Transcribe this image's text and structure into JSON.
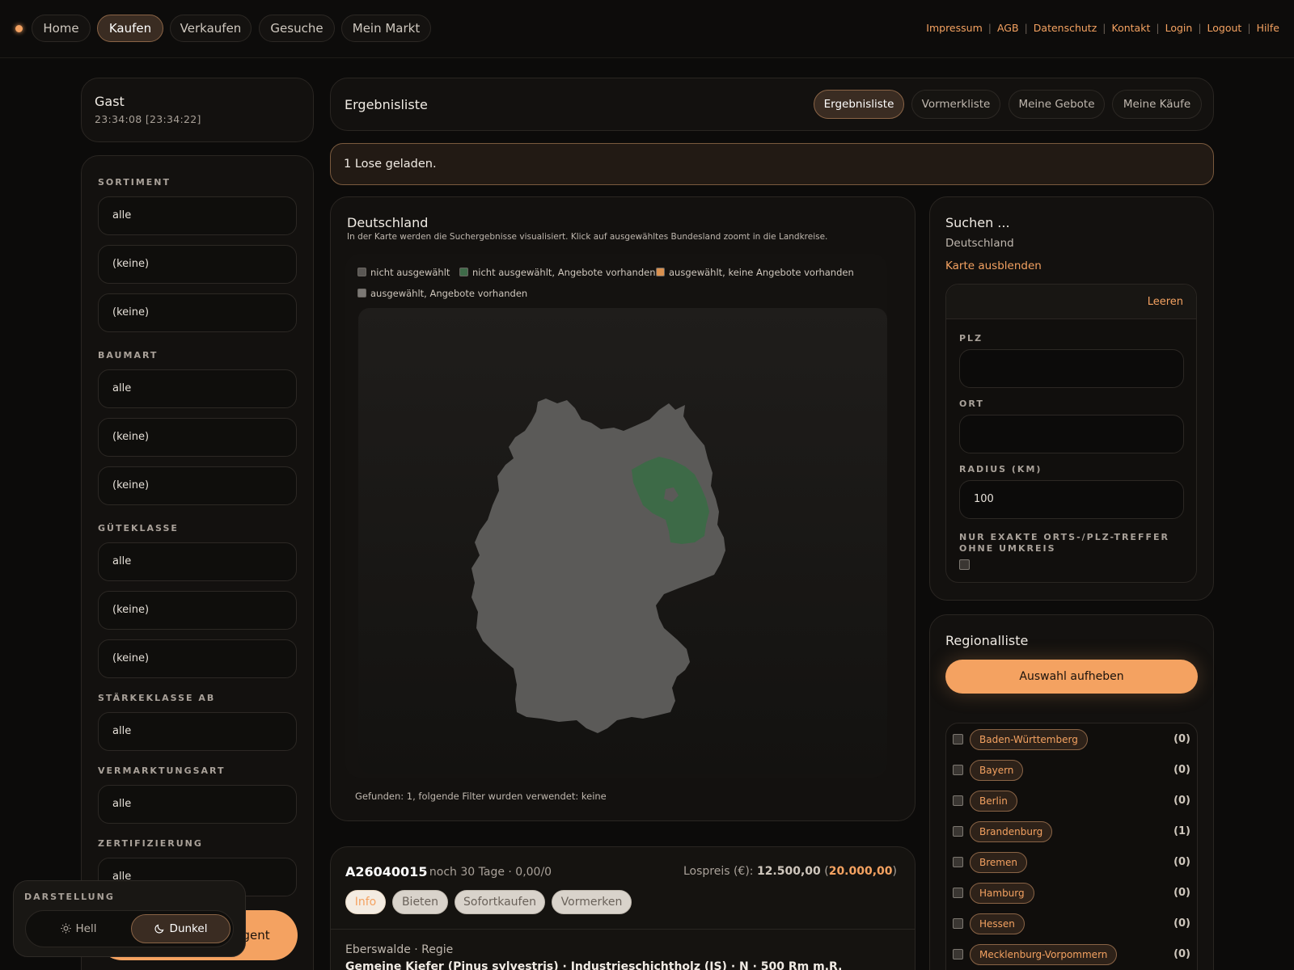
{
  "nav": {
    "items": [
      "Home",
      "Kaufen",
      "Verkaufen",
      "Gesuche",
      "Mein Markt"
    ],
    "active": "Kaufen",
    "links": [
      "Impressum",
      "AGB",
      "Datenschutz",
      "Kontakt",
      "Login",
      "Logout",
      "Hilfe"
    ]
  },
  "user": {
    "name": "Gast",
    "time": "23:34:08  [23:34:22]"
  },
  "filters": {
    "sortiment": {
      "label": "SORTIMENT",
      "values": [
        "alle",
        "(keine)",
        "(keine)"
      ]
    },
    "baumart": {
      "label": "BAUMART",
      "values": [
        "alle",
        "(keine)",
        "(keine)"
      ]
    },
    "gueteklasse": {
      "label": "GÜTEKLASSE",
      "values": [
        "alle",
        "(keine)",
        "(keine)"
      ]
    },
    "staerkeklasse": {
      "label": "STÄRKEKLASSE AB",
      "values": [
        "alle"
      ]
    },
    "vermarktungsart": {
      "label": "VERMARKTUNGSART",
      "values": [
        "alle"
      ]
    },
    "zertifizierung": {
      "label": "ZERTIFIZIERUNG",
      "values": [
        "alle"
      ]
    },
    "button_partial": "ngent"
  },
  "theme": {
    "label": "DARSTELLUNG",
    "light": "Hell",
    "dark": "Dunkel",
    "active": "Dunkel"
  },
  "header": {
    "title": "Ergebnisliste",
    "tabs": [
      "Ergebnisliste",
      "Vormerkliste",
      "Meine Gebote",
      "Meine Käufe"
    ],
    "active_tab": "Ergebnisliste"
  },
  "notice": "1 Lose geladen.",
  "map": {
    "title": "Deutschland",
    "subtitle": "In der Karte werden die Suchergebnisse visualisiert. Klick auf ausgewähltes Bundesland zoomt in die Landkreise.",
    "legend": [
      {
        "label": "nicht ausgewählt",
        "color": "#5a5754"
      },
      {
        "label": "nicht ausgewählt, Angebote vorhanden",
        "color": "#3f6b49"
      },
      {
        "label": "ausgewählt, keine Angebote vorhanden",
        "color": "#d9904f"
      },
      {
        "label": "ausgewählt, Angebote vorhanden",
        "color": "#7b7874"
      }
    ],
    "fill_default": "#5b5a58",
    "fill_offers": "#3d6a47",
    "found_text": "Gefunden: 1, folgende Filter wurden verwendet: keine"
  },
  "lot": {
    "id": "A26040015",
    "meta": "· noch 30 Tage · 0,00/0",
    "price_label": "Lospreis (€):",
    "price": "12.500,00",
    "price_max": "20.000,00",
    "buttons": [
      "Info",
      "Bieten",
      "Sofortkaufen",
      "Vormerken"
    ],
    "location": "Eberswalde · Regie",
    "description": "Gemeine Kiefer (Pinus sylvestris) · Industrieschichtholz (IS) · N · 500 Rm m.R."
  },
  "search": {
    "title": "Suchen ...",
    "region": "Deutschland",
    "hide_map": "Karte ausblenden",
    "clear": "Leeren",
    "plz_label": "PLZ",
    "plz_value": "",
    "ort_label": "ORT",
    "ort_value": "",
    "radius_label": "RADIUS (KM)",
    "radius_value": "100",
    "exact_label_1": "NUR EXAKTE ORTS-/PLZ-TREFFER",
    "exact_label_2": "OHNE UMKREIS",
    "exact_checked": false
  },
  "regional": {
    "title": "Regionalliste",
    "clear_button": "Auswahl aufheben",
    "items": [
      {
        "name": "Baden-Württemberg",
        "count": "(0)"
      },
      {
        "name": "Bayern",
        "count": "(0)"
      },
      {
        "name": "Berlin",
        "count": "(0)"
      },
      {
        "name": "Brandenburg",
        "count": "(1)"
      },
      {
        "name": "Bremen",
        "count": "(0)"
      },
      {
        "name": "Hamburg",
        "count": "(0)"
      },
      {
        "name": "Hessen",
        "count": "(0)"
      },
      {
        "name": "Mecklenburg-Vorpommern",
        "count": "(0)"
      }
    ]
  }
}
